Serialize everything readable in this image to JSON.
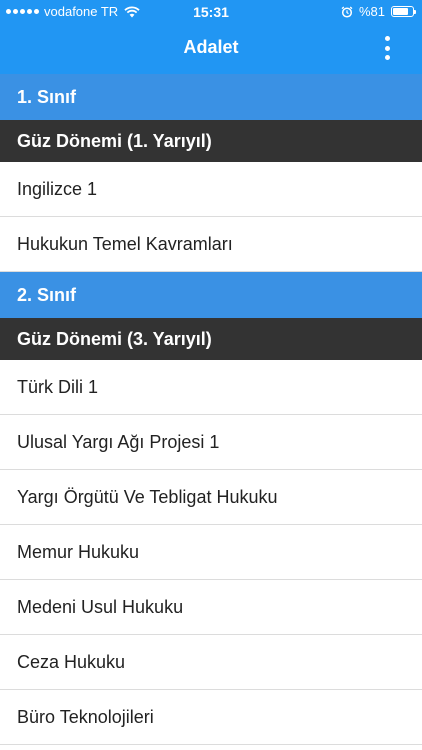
{
  "status_bar": {
    "carrier": "vodafone TR",
    "time": "15:31",
    "battery": "%81",
    "battery_level": 0.81,
    "icons": [
      "signal-dots-icon",
      "wifi-icon",
      "alarm-icon",
      "battery-icon"
    ]
  },
  "app_bar": {
    "title": "Adalet",
    "menu_icon": "more-vertical-icon",
    "background": "#2196f3"
  },
  "colors": {
    "year_header": "#3a91e4",
    "term_header": "#333333",
    "row_divider": "#dcdcdc"
  },
  "sections": [
    {
      "year": "1. Sınıf",
      "term": "Güz Dönemi (1. Yarıyıl)",
      "courses": [
        "Ingilizce 1",
        "Hukukun Temel Kavramları"
      ]
    },
    {
      "year": "2. Sınıf",
      "term": "Güz Dönemi (3. Yarıyıl)",
      "courses": [
        "Türk Dili 1",
        "Ulusal Yargı Ağı Projesi 1",
        "Yargı Örgütü Ve Tebligat Hukuku",
        "Memur Hukuku",
        "Medeni Usul Hukuku",
        "Ceza Hukuku",
        "Büro Teknolojileri"
      ]
    }
  ]
}
